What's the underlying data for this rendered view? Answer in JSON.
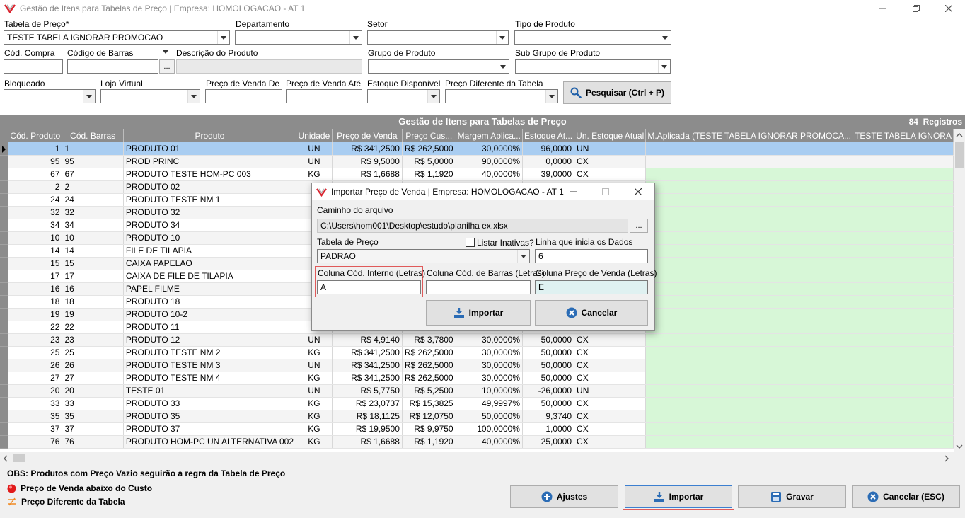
{
  "window": {
    "title": "Gestão de Itens para Tabelas de Preço | Empresa: HOMOLOGACAO - AT 1"
  },
  "filters": {
    "tabela_label": "Tabela de Preço*",
    "tabela_value": "TESTE TABELA IGNORAR PROMOCAO",
    "departamento_label": "Departamento",
    "setor_label": "Setor",
    "tipo_label": "Tipo de Produto",
    "cod_compra_label": "Cód. Compra",
    "cod_barras_label": "Código de Barras",
    "dots": "...",
    "descricao_label": "Descrição do Produto",
    "grupo_label": "Grupo de Produto",
    "subgrupo_label": "Sub Grupo de Produto",
    "bloqueado_label": "Bloqueado",
    "loja_label": "Loja Virtual",
    "preco_de_label": "Preço de Venda De",
    "preco_ate_label": "Preço de Venda Até",
    "estoque_label": "Estoque Disponível",
    "preco_dif_label": "Preço Diferente da Tabela",
    "pesquisar": "Pesquisar (Ctrl + P)"
  },
  "grid": {
    "title": "Gestão de Itens para Tabelas de Preço",
    "count": "84",
    "count_label": "Registros",
    "columns": [
      "Cód. Produto",
      "Cód. Barras",
      "Produto",
      "Unidade",
      "Preço de Venda",
      "Preço Cus...",
      "Margem Aplica...",
      "Estoque At...",
      "Un. Estoque Atual",
      "M.Aplicada (TESTE TABELA IGNORAR PROMOCA...",
      "TESTE TABELA IGNORA"
    ],
    "rows": [
      [
        "1",
        "1",
        "PRODUTO 01",
        "UN",
        "R$ 341,2500",
        "R$ 262,5000",
        "30,0000%",
        "96,0000",
        "UN"
      ],
      [
        "95",
        "95",
        "PROD PRINC",
        "UN",
        "R$ 9,5000",
        "R$ 5,0000",
        "90,0000%",
        "0,0000",
        "CX"
      ],
      [
        "67",
        "67",
        "PRODUTO TESTE HOM-PC 003",
        "KG",
        "R$ 1,6688",
        "R$ 1,1920",
        "40,0000%",
        "39,0000",
        "CX"
      ],
      [
        "2",
        "2",
        "PRODUTO 02",
        "",
        "",
        "",
        "",
        "",
        ""
      ],
      [
        "24",
        "24",
        "PRODUTO TESTE NM 1",
        "",
        "",
        "",
        "",
        "",
        ""
      ],
      [
        "32",
        "32",
        "PRODUTO 32",
        "",
        "",
        "",
        "",
        "",
        ""
      ],
      [
        "34",
        "34",
        "PRODUTO 34",
        "",
        "",
        "",
        "",
        "",
        ""
      ],
      [
        "10",
        "10",
        "PRODUTO 10",
        "",
        "",
        "",
        "",
        "",
        ""
      ],
      [
        "14",
        "14",
        "FILE DE TILAPIA",
        "",
        "",
        "",
        "",
        "",
        ""
      ],
      [
        "15",
        "15",
        "CAIXA PAPELAO",
        "",
        "",
        "",
        "",
        "",
        ""
      ],
      [
        "17",
        "17",
        "CAIXA DE FILE DE TILAPIA",
        "",
        "",
        "",
        "",
        "",
        ""
      ],
      [
        "16",
        "16",
        "PAPEL FILME",
        "",
        "",
        "",
        "",
        "",
        ""
      ],
      [
        "18",
        "18",
        "PRODUTO 18",
        "",
        "",
        "",
        "",
        "",
        ""
      ],
      [
        "19",
        "19",
        "PRODUTO 10-2",
        "",
        "",
        "",
        "",
        "",
        ""
      ],
      [
        "22",
        "22",
        "PRODUTO 11",
        "",
        "",
        "",
        "",
        "",
        ""
      ],
      [
        "23",
        "23",
        "PRODUTO 12",
        "UN",
        "R$ 4,9140",
        "R$ 3,7800",
        "30,0000%",
        "50,0000",
        "CX"
      ],
      [
        "25",
        "25",
        "PRODUTO TESTE NM 2",
        "KG",
        "R$ 341,2500",
        "R$ 262,5000",
        "30,0000%",
        "50,0000",
        "CX"
      ],
      [
        "26",
        "26",
        "PRODUTO TESTE NM 3",
        "UN",
        "R$ 341,2500",
        "R$ 262,5000",
        "30,0000%",
        "50,0000",
        "CX"
      ],
      [
        "27",
        "27",
        "PRODUTO TESTE NM 4",
        "KG",
        "R$ 341,2500",
        "R$ 262,5000",
        "30,0000%",
        "50,0000",
        "CX"
      ],
      [
        "20",
        "20",
        "TESTE 01",
        "UN",
        "R$ 5,7750",
        "R$ 5,2500",
        "10,0000%",
        "-26,0000",
        "UN"
      ],
      [
        "33",
        "33",
        "PRODUTO 33",
        "KG",
        "R$ 23,0737",
        "R$ 15,3825",
        "49,9997%",
        "50,0000",
        "CX"
      ],
      [
        "35",
        "35",
        "PRODUTO 35",
        "KG",
        "R$ 18,1125",
        "R$ 12,0750",
        "50,0000%",
        "9,3740",
        "CX"
      ],
      [
        "37",
        "37",
        "PRODUTO 37",
        "KG",
        "R$ 19,9500",
        "R$ 9,9750",
        "100,0000%",
        "1,0000",
        "CX"
      ],
      [
        "76",
        "76",
        "PRODUTO HOM-PC UN ALTERNATIVA 002",
        "KG",
        "R$ 1,6688",
        "R$ 1,1920",
        "40,0000%",
        "25,0000",
        "CX"
      ]
    ]
  },
  "footer": {
    "obs": "OBS: Produtos com Preço Vazio seguirão a regra da Tabela de Preço",
    "legend_red": "Preço de Venda abaixo do Custo",
    "legend_diff": "Preço Diferente da Tabela",
    "ajustes": "Ajustes",
    "importar": "Importar",
    "gravar": "Gravar",
    "cancelar": "Cancelar (ESC)"
  },
  "dialog": {
    "title": "Importar Preço de Venda | Empresa: HOMOLOGACAO - AT 1",
    "caminho_label": "Caminho do arquivo",
    "caminho_value": "C:\\Users\\hom001\\Desktop\\estudo\\planilha ex.xlsx",
    "dots": "...",
    "tabela_label": "Tabela de Preço",
    "listar_label": "Listar Inativas?",
    "tabela_value": "PADRAO",
    "linha_label": "Linha que inicia os Dados",
    "linha_value": "6",
    "col_interno_label": "Coluna Cód. Interno (Letras)",
    "col_interno_value": "A",
    "col_barras_label": "Coluna Cód. de Barras (Letras)",
    "col_barras_value": "",
    "col_preco_label": "Coluna Preço de Venda (Letras)",
    "col_preco_value": "E",
    "importar": "Importar",
    "cancelar": "Cancelar"
  },
  "colors": {
    "selected_row": "#a9cdf1",
    "green_cell": "#d7f7d7",
    "grid_header": "#8c8c8c",
    "highlight": "#e05a5a",
    "button_blue": "#2b6cb5"
  }
}
